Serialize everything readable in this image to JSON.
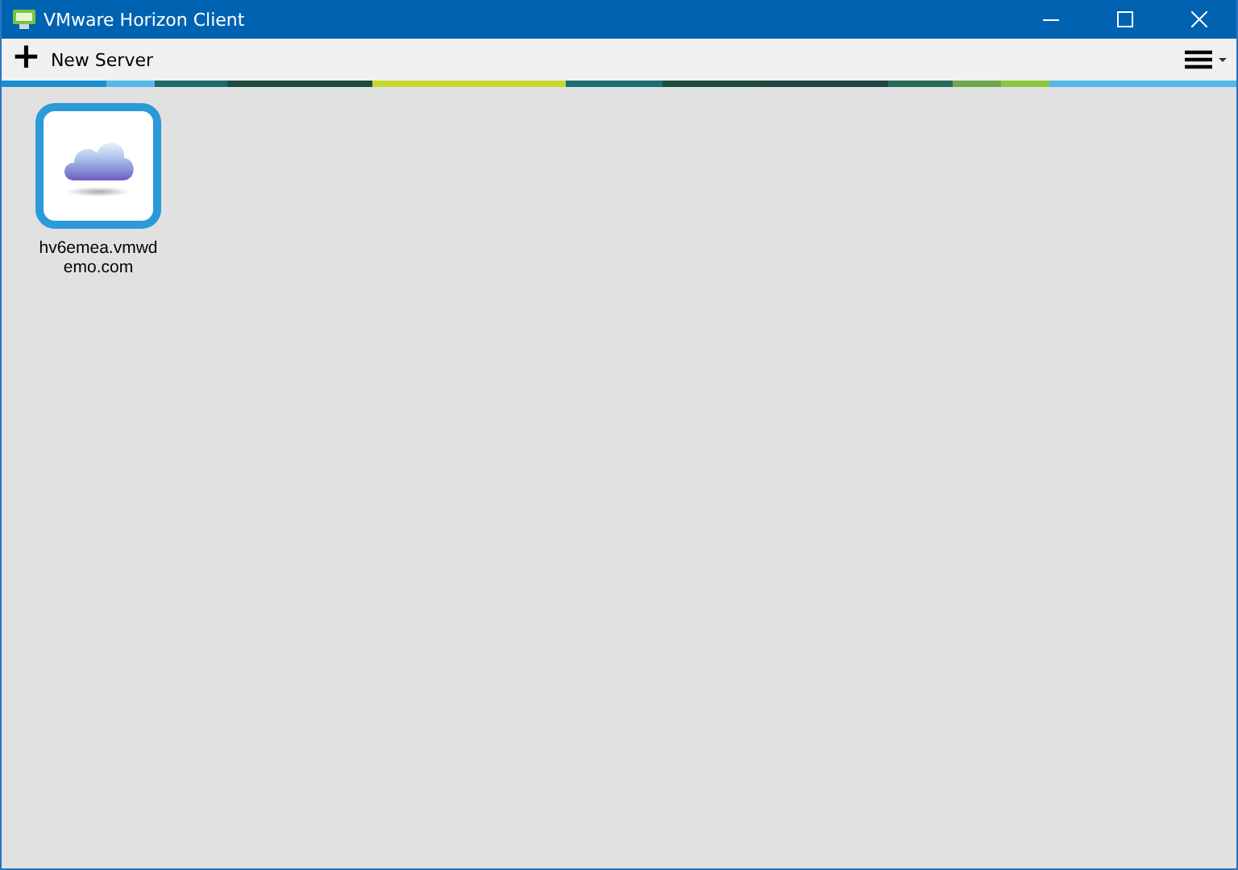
{
  "window": {
    "title": "VMware Horizon Client"
  },
  "toolbar": {
    "new_server": {
      "icon": "+",
      "label": "New Server"
    }
  },
  "servers": [
    {
      "name": "hv6emea.vmwdemo.com",
      "selected": true
    }
  ]
}
